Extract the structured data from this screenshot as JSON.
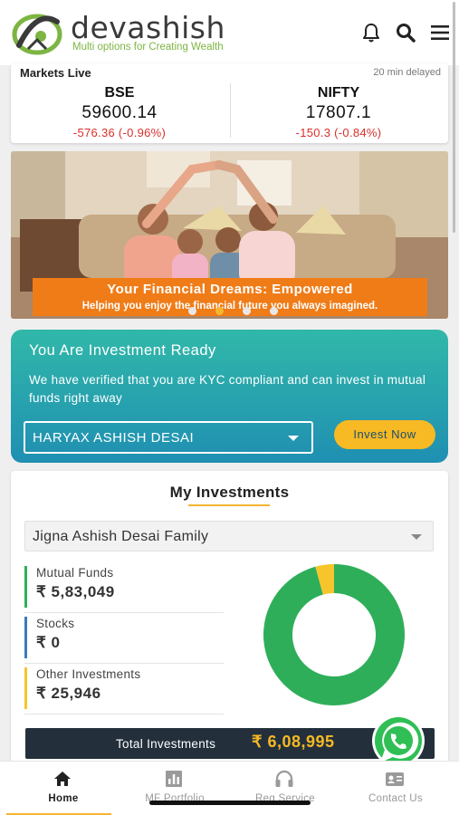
{
  "header": {
    "brand_name": "devashish",
    "tagline": "Multi options for Creating Wealth",
    "icons": [
      "bell-icon",
      "search-icon",
      "menu-icon"
    ]
  },
  "markets": {
    "title": "Markets Live",
    "delay_note": "20 min delayed",
    "bse": {
      "name": "BSE",
      "value": "59600.14",
      "change": "-576.36  (-0.96%)"
    },
    "nifty": {
      "name": "NIFTY",
      "value": "17807.1",
      "change": "-150.3  (-0.84%)"
    }
  },
  "banner": {
    "title": "Your Financial Dreams: Empowered",
    "subtitle": "Helping you enjoy the financial future you always imagined.",
    "slide_count": 4,
    "active_slide": 2
  },
  "investment_ready": {
    "title": "You Are Investment Ready",
    "description": "We have verified that you are KYC compliant and can invest in mutual funds right away",
    "selected_investor": "HARYAX ASHISH DESAI",
    "invest_button": "Invest Now"
  },
  "my_investments": {
    "title": "My Investments",
    "selected_family": "Jigna Ashish Desai Family",
    "categories": [
      {
        "label": "Mutual Funds",
        "value": "₹ 5,83,049",
        "color": "#2fae5a"
      },
      {
        "label": "Stocks",
        "value": "₹ 0",
        "color": "#3a7bbf"
      },
      {
        "label": "Other Investments",
        "value": "₹ 25,946",
        "color": "#f5c52b"
      }
    ],
    "total_label": "Total Investments",
    "total_value": "₹ 6,08,995"
  },
  "chart_data": {
    "type": "pie",
    "categories": [
      "Mutual Funds",
      "Stocks",
      "Other Investments"
    ],
    "values": [
      583049,
      0,
      25946
    ],
    "colors": [
      "#2fae5a",
      "#3a7bbf",
      "#f5c52b"
    ]
  },
  "bottom_nav": {
    "items": [
      {
        "label": "Home",
        "icon": "home-icon",
        "active": true
      },
      {
        "label": "MF Portfolio",
        "icon": "bar-chart-icon",
        "active": false
      },
      {
        "label": "Req Service",
        "icon": "headset-icon",
        "active": false
      },
      {
        "label": "Contact Us",
        "icon": "contact-card-icon",
        "active": false
      }
    ]
  },
  "colors": {
    "accent": "#f5b531",
    "brand_green": "#7db543",
    "ready_gradient_top": "#31b8a9",
    "ready_gradient_bottom": "#1f8fb2",
    "negative": "#d9302b"
  }
}
